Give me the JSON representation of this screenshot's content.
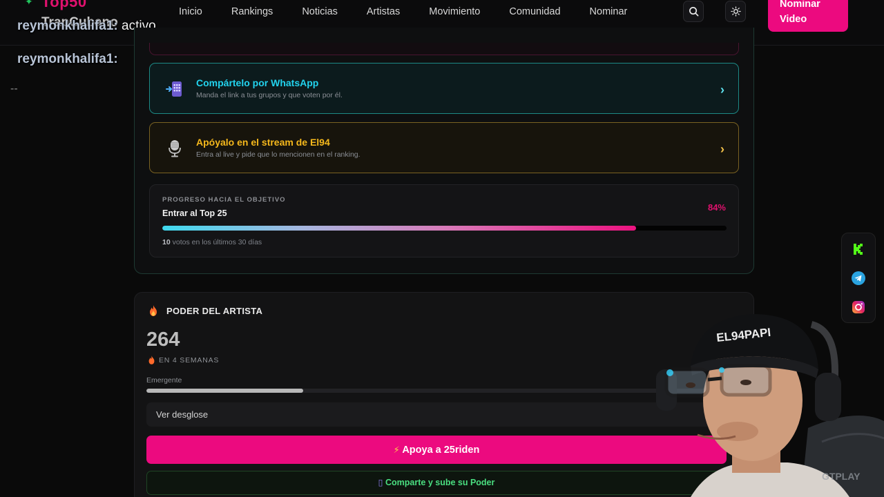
{
  "header": {
    "logo": "Top50",
    "nav": [
      "Inicio",
      "Rankings",
      "Noticias",
      "Artistas",
      "Movimiento",
      "Comunidad",
      "Nominar"
    ],
    "nominate_label": "Nominar Video",
    "search_icon": "search-icon",
    "theme_icon": "sun-icon"
  },
  "overlay": {
    "brand": "TrapCubano",
    "chat": [
      {
        "user": "reymonkhalifa1:",
        "msg": "activo"
      },
      {
        "user": "reymonkhalifa1:",
        "msg": ""
      }
    ],
    "badge": "94\nPAPI",
    "dash": "--"
  },
  "actions": {
    "whatsapp": {
      "title": "Compártelo por WhatsApp",
      "subtitle": "Manda el link a tus grupos y que voten por él.",
      "icon": "phone-share-icon"
    },
    "stream": {
      "title": "Apóyalo en el stream de El94",
      "subtitle": "Entra al live y pide que lo mencionen en el ranking.",
      "icon": "microphone-icon"
    }
  },
  "progress": {
    "label": "PROGRESO HACIA EL OBJETIVO",
    "goal": "Entrar al Top 25",
    "percent_text": "84%",
    "percent": 84,
    "votes_count": "10",
    "votes_text": "votos en los últimos 30 días"
  },
  "artist_power": {
    "title": "PODER DEL ARTISTA",
    "score": "264",
    "period": "EN 4 SEMANAS",
    "level": "Emergente",
    "level_fraction": 0.27,
    "breakdown_label": "Ver desglose",
    "support_label": "Apoya a 25riden",
    "share_label": "Comparte y sube su Poder"
  },
  "social": [
    "kick-icon",
    "telegram-icon",
    "instagram-icon"
  ],
  "colors": {
    "accent_pink": "#ec0a7f",
    "whatsapp_cyan": "#22d3ee",
    "stream_gold": "#f5b81c",
    "share_green": "#4ade80"
  }
}
